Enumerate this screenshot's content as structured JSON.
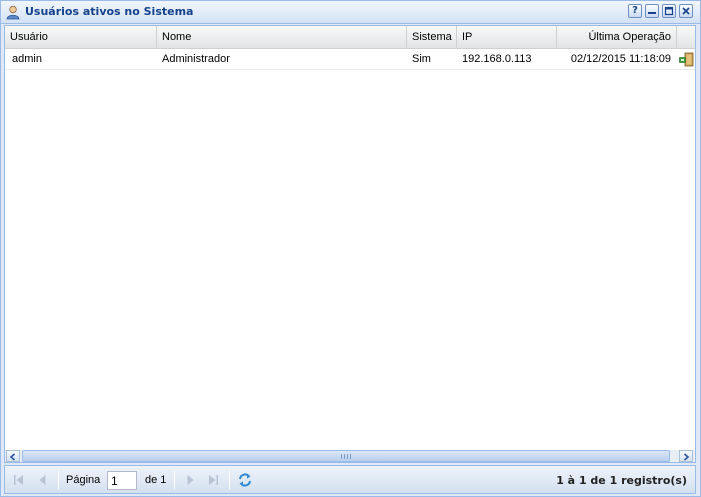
{
  "window": {
    "title": "Usuários ativos no Sistema",
    "tools": {
      "help": "?",
      "minimize": "minimize-icon",
      "maximize": "maximize-icon",
      "close": "close-icon"
    }
  },
  "grid": {
    "columns": [
      "Usuário",
      "Nome",
      "Sistema",
      "IP",
      "Última Operação"
    ],
    "rows": [
      {
        "usuario": "admin",
        "nome": "Administrador",
        "sistema": "Sim",
        "ip": "192.168.0.113",
        "ultima_operacao": "02/12/2015 11:18:09",
        "action_icon": "logout-door-icon"
      }
    ]
  },
  "paging": {
    "page_label": "Página",
    "page_value": "1",
    "of_label": "de 1",
    "info": "1 à 1 de 1 registro(s)"
  },
  "colors": {
    "title": "#15428b",
    "border": "#99bbe8",
    "panel_bg": "#dfe8f6"
  }
}
